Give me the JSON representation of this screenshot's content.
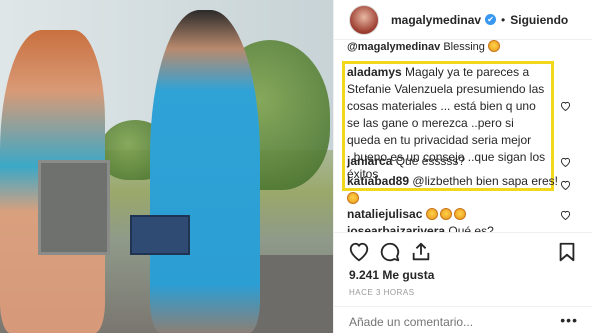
{
  "header": {
    "username": "magalymedinav",
    "verified_symbol": "✔",
    "separator": "•",
    "follow_label": "Siguiendo"
  },
  "comments": {
    "top_partial": {
      "user": "@magalymedinav",
      "text": "Blessing"
    },
    "items": [
      {
        "user": "aladamys",
        "text": "Magaly ya te pareces a Stefanie Valenzuela presumiendo las cosas materiales ... está bien q uno se las gane o merezca ..pero si queda en tu privacidad seria mejor ..bueno es un consejo ..que sigan los éxitos"
      },
      {
        "user": "janiarca",
        "text": "Que esssss?"
      },
      {
        "user": "katiabad89",
        "text": "@lizbetheh bien sapa eres!"
      },
      {
        "user": "nataliejulisac",
        "text": ""
      },
      {
        "user": "josearbaizarivera",
        "text": "Qué es?"
      }
    ]
  },
  "actions": {
    "like_icon": "heart-icon",
    "comment_icon": "comment-icon",
    "share_icon": "share-icon",
    "save_icon": "bookmark-icon"
  },
  "likes": "9.241 Me gusta",
  "time": "HACE 3 HORAS",
  "add_comment_placeholder": "Añade un comentario...",
  "more_label": "•••",
  "colors": {
    "highlight": "#f2d81c",
    "verified": "#3897f0",
    "text": "#262626",
    "muted": "#999999"
  }
}
